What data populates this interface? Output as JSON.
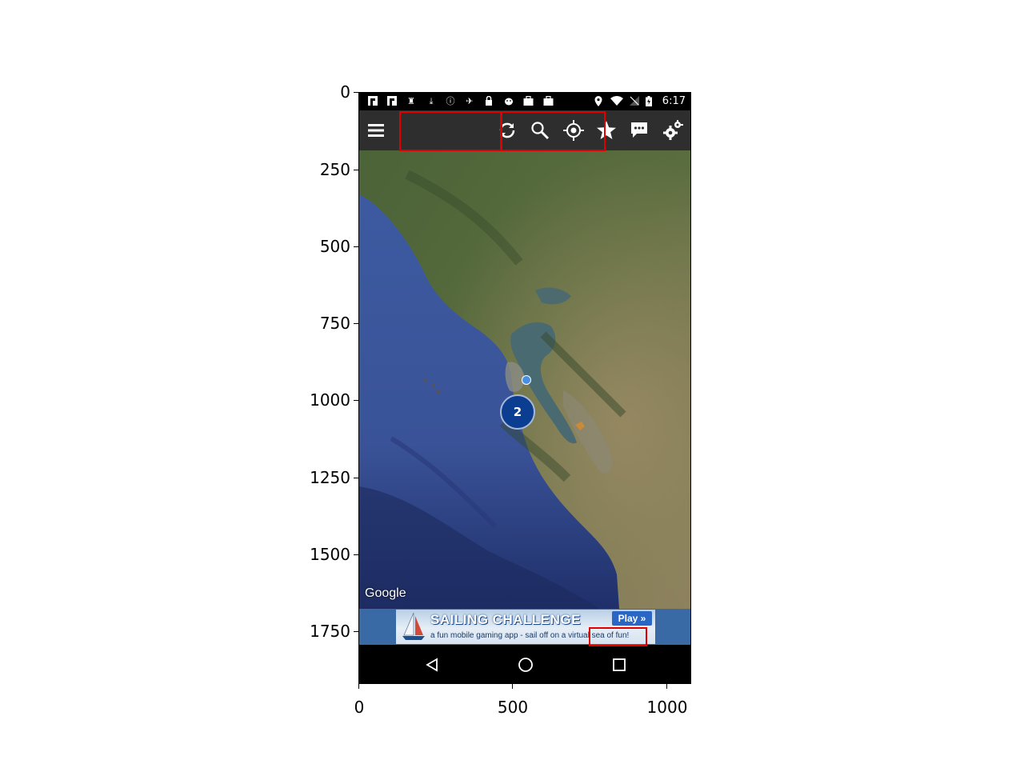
{
  "figure": {
    "y_ticks": [
      "0",
      "250",
      "500",
      "750",
      "1000",
      "1250",
      "1500",
      "1750"
    ],
    "x_ticks": [
      "0",
      "500",
      "1000"
    ]
  },
  "status_bar": {
    "time": "6:17",
    "left_icons": [
      "flipboard-icon",
      "flipboard-icon",
      "chess-icon",
      "download-icon",
      "info-icon",
      "satellite-icon",
      "lock-icon",
      "android-icon",
      "bag-icon",
      "bag-icon"
    ],
    "right_icons": [
      "location-icon",
      "wifi-icon",
      "no-signal-icon",
      "battery-charging-icon"
    ]
  },
  "toolbar": {
    "icons": [
      "menu-icon",
      "refresh-icon",
      "search-icon",
      "my-location-icon",
      "star-icon",
      "chat-icon",
      "settings-icon"
    ]
  },
  "map": {
    "attribution": "Google",
    "cluster_count": "2"
  },
  "ad": {
    "title": "SAILING CHALLENGE",
    "subtitle": "a fun mobile gaming app - sail off on a virtual sea of fun!",
    "play_label": "Play »"
  },
  "nav_bar": {
    "icons": [
      "back-icon",
      "home-icon",
      "recents-icon"
    ]
  }
}
